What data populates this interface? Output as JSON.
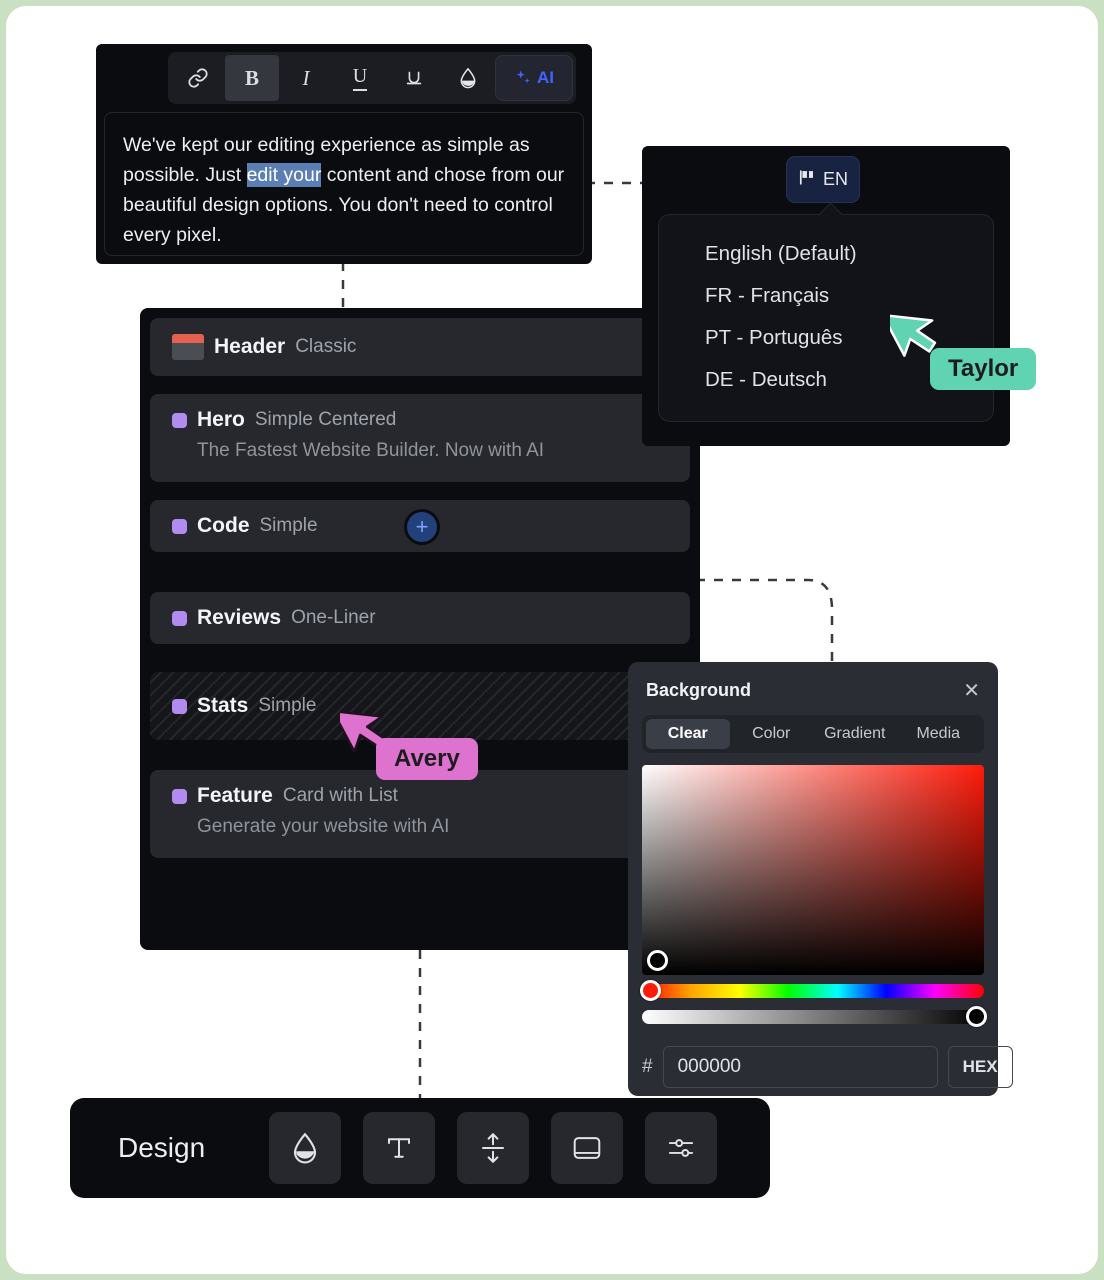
{
  "theme": {
    "frame_color": "#c9e0c2",
    "panel_bg": "#0b0c10",
    "row_bg": "#26282e",
    "accent_blue": "#4263ff",
    "accent_purple": "#b18bf0",
    "taylor_color": "#5fd3b2",
    "avery_color": "#dd72cf"
  },
  "editor": {
    "toolbar": [
      {
        "name": "link-icon",
        "glyph": "⚓",
        "label": "Link",
        "active": false
      },
      {
        "name": "bold-icon",
        "glyph": "B",
        "label": "Bold",
        "active": true
      },
      {
        "name": "italic-icon",
        "glyph": "I",
        "label": "Italic",
        "active": false
      },
      {
        "name": "underline-icon",
        "glyph": "U",
        "label": "Underline",
        "active": false
      },
      {
        "name": "strikethrough-icon",
        "glyph": "U",
        "label": "Strikethrough",
        "active": false
      },
      {
        "name": "color-drop-icon",
        "glyph": "◆",
        "label": "Text color",
        "active": false
      }
    ],
    "ai_label": "AI",
    "text_before": "We've kept our editing experience as simple as possible. Just ",
    "text_selected": "edit your",
    "text_after": " content and chose from our beautiful design options. You don't need to control every pixel."
  },
  "language": {
    "button_label": "EN",
    "button_icon": "flag-icon",
    "items": [
      {
        "label": "English (Default)"
      },
      {
        "label": "FR - Français"
      },
      {
        "label": "PT - Português"
      },
      {
        "label": "DE - Deutsch"
      }
    ]
  },
  "sections": {
    "add_button_label": "+",
    "rows": [
      {
        "name": "Header",
        "variant": "Classic",
        "sub": "",
        "icon": "header-thumbnail-icon",
        "striped": false
      },
      {
        "name": "Hero",
        "variant": "Simple Centered",
        "sub": "The Fastest Website Builder. Now with AI",
        "icon": "dot-icon",
        "striped": false
      },
      {
        "name": "Code",
        "variant": "Simple",
        "sub": "",
        "icon": "dot-icon",
        "striped": false
      },
      {
        "name": "Reviews",
        "variant": "One-Liner",
        "sub": "",
        "icon": "dot-icon",
        "striped": false
      },
      {
        "name": "Stats",
        "variant": "Simple",
        "sub": "",
        "icon": "dot-icon",
        "striped": true
      },
      {
        "name": "Feature",
        "variant": "Card with List",
        "sub": "Generate your website with AI",
        "icon": "dot-icon",
        "striped": false
      }
    ]
  },
  "background_panel": {
    "title": "Background",
    "close_label": "✕",
    "tabs": [
      {
        "label": "Clear",
        "active": true
      },
      {
        "label": "Color",
        "active": false
      },
      {
        "label": "Gradient",
        "active": false
      },
      {
        "label": "Media",
        "active": false
      }
    ],
    "hash_symbol": "#",
    "hex_value": "000000",
    "hex_placeholder": "000000",
    "mode_label": "HEX"
  },
  "design_bar": {
    "label": "Design",
    "buttons": [
      {
        "name": "color-drop-icon",
        "label": "Color"
      },
      {
        "name": "typography-icon",
        "label": "Typography"
      },
      {
        "name": "spacing-icon",
        "label": "Spacing"
      },
      {
        "name": "layout-icon",
        "label": "Layout"
      },
      {
        "name": "settings-icon",
        "label": "Settings"
      }
    ]
  },
  "cursors": [
    {
      "name": "Taylor",
      "color": "#5fd3b2"
    },
    {
      "name": "Avery",
      "color": "#dd72cf"
    }
  ]
}
